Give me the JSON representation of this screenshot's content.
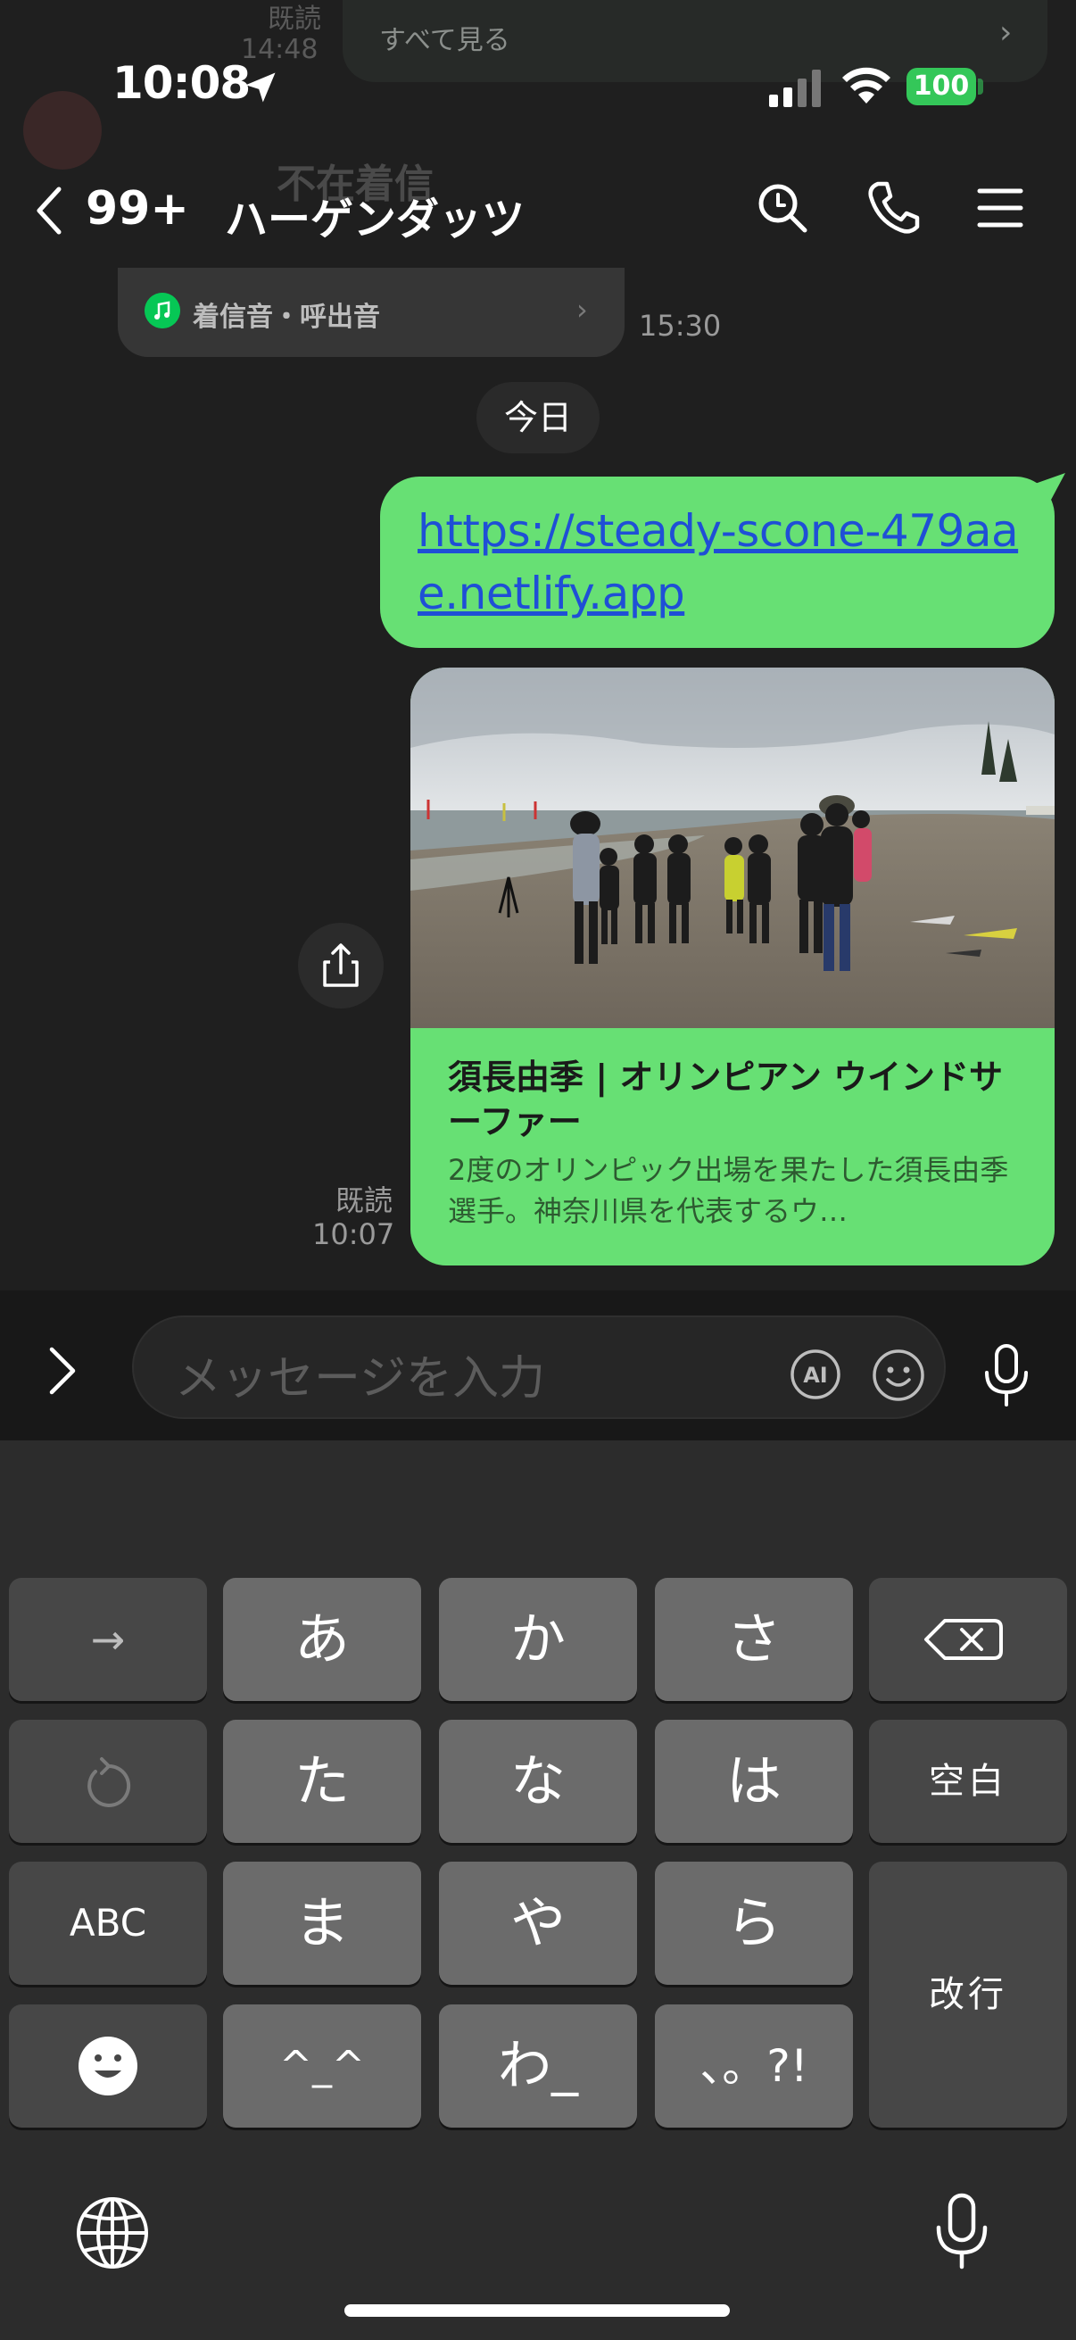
{
  "background": {
    "toast_text": "すべて見る",
    "read_label": "既読",
    "time": "14:48",
    "missed_call": "不在着信"
  },
  "status_bar": {
    "time": "10:08",
    "battery": "100"
  },
  "header": {
    "back_count": "99+",
    "title": "ハーゲンダッツ"
  },
  "ringtone_card": {
    "label": "着信音・呼出音",
    "time": "15:30"
  },
  "date_separator": "今日",
  "message": {
    "link": "https://steady-scone-479aae.netlify.app",
    "read_label": "既読",
    "time": "10:07",
    "preview": {
      "title": "須長由季 | オリンピアン ウインドサーファー",
      "description": "2度のオリンピック出場を果たした須長由季選手。神奈川県を代表するウ…"
    }
  },
  "input": {
    "placeholder": "メッセージを入力",
    "ai_label": "AI"
  },
  "keyboard": {
    "rows": [
      [
        "→",
        "あ",
        "か",
        "さ",
        "⌫"
      ],
      [
        "↺",
        "た",
        "な",
        "は",
        "空白"
      ],
      [
        "ABC",
        "ま",
        "や",
        "ら",
        "改行"
      ],
      [
        "☺",
        "^_^",
        "わ_",
        "、。?!"
      ]
    ]
  },
  "colors": {
    "bubble": "#67e074",
    "link": "#1f4fd6",
    "battery": "#34c759",
    "line_green": "#06c755"
  }
}
